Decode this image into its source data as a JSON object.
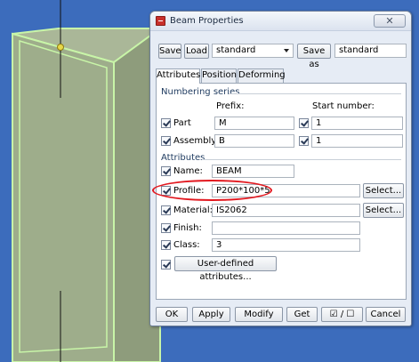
{
  "dialog": {
    "title": "Beam Properties",
    "close_glyph": "✕"
  },
  "toolbar": {
    "save_label": "Save",
    "load_label": "Load",
    "load_value": "standard",
    "save_as_label": "Save as",
    "save_as_value": "standard"
  },
  "tabs": [
    {
      "label": "Attributes",
      "active": true
    },
    {
      "label": "Position",
      "active": false
    },
    {
      "label": "Deforming",
      "active": false
    }
  ],
  "numbering": {
    "title": "Numbering series",
    "prefix_header": "Prefix:",
    "start_header": "Start number:",
    "rows": [
      {
        "label": "Part",
        "prefix": "M",
        "start": "1",
        "checked": true,
        "start_checked": true
      },
      {
        "label": "Assembly",
        "prefix": "B",
        "start": "1",
        "checked": true,
        "start_checked": true
      }
    ]
  },
  "attributes": {
    "title": "Attributes",
    "name_label": "Name:",
    "name_value": "BEAM",
    "profile_label": "Profile:",
    "profile_value": "P200*100*5",
    "material_label": "Material:",
    "material_value": "IS2062",
    "finish_label": "Finish:",
    "finish_value": "",
    "class_label": "Class:",
    "class_value": "3",
    "select_label": "Select...",
    "uda_label": "User-defined attributes..."
  },
  "footer": {
    "ok": "OK",
    "apply": "Apply",
    "modify": "Modify",
    "get": "Get",
    "toggle": "☑ / ☐",
    "cancel": "Cancel"
  },
  "colors": {
    "viewport_bg": "#3d6dbd",
    "beam_fill": "#9ead8b",
    "beam_edge": "#c8f5a8",
    "highlight": "#e2181f"
  }
}
